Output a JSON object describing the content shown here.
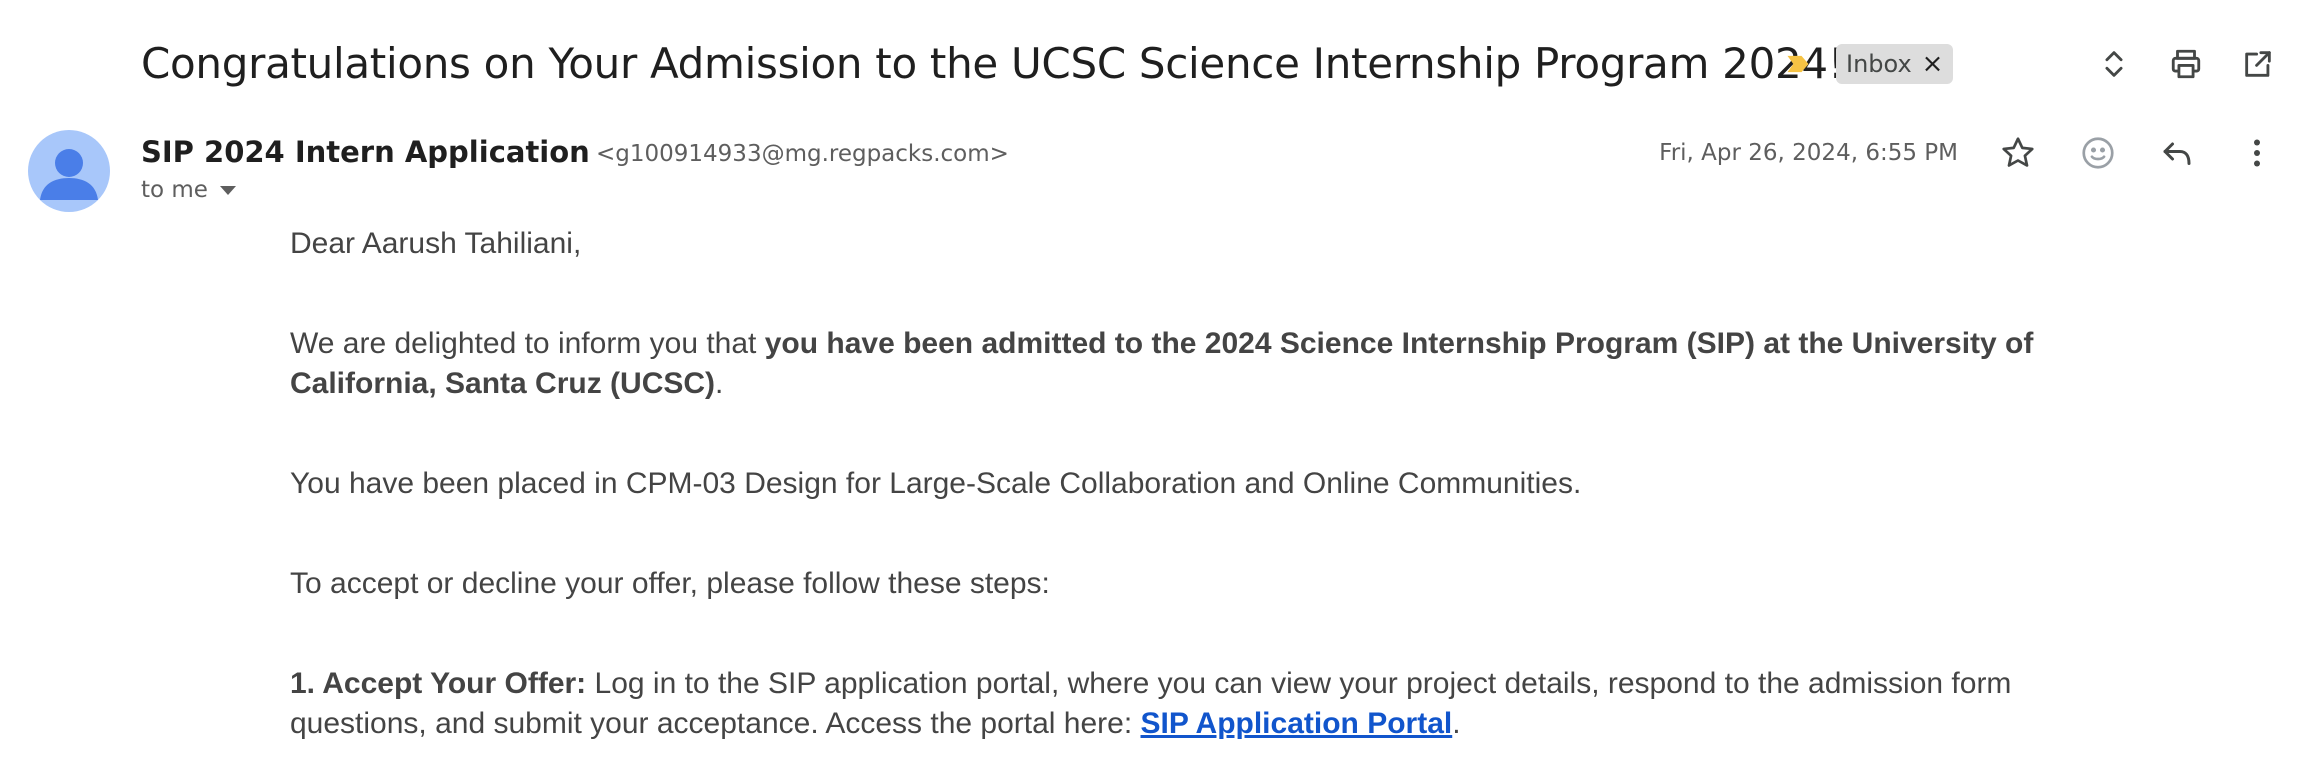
{
  "email": {
    "subject": "Congratulations on Your Admission to the UCSC Science Internship Program 2024!",
    "label": "Inbox",
    "label_remove": "×",
    "sender": {
      "name": "SIP 2024 Intern Application",
      "email": "<g100914933@mg.regpacks.com>",
      "recipient": "to me"
    },
    "date": "Fri, Apr 26, 2024, 6:55 PM",
    "body": {
      "greeting": "Dear Aarush Tahiliani,",
      "p1_start": "We are delighted to inform you that ",
      "p1_bold": "you have been admitted to the 2024 Science Internship Program (SIP) at the University of California, Santa Cruz (UCSC)",
      "p1_end": ".",
      "p2": "You have been placed in CPM-03 Design for Large-Scale Collaboration and Online Communities.",
      "p3": "To accept or decline your offer, please follow these steps:",
      "step1_title": "1. Accept Your Offer:",
      "step1_text": " Log in to the SIP application portal, where you can view your project details, respond to the admission form questions, and submit your acceptance. Access the portal here: ",
      "step1_link": "SIP Application Portal",
      "step1_end": "."
    }
  },
  "icons": {
    "important_marker": "label-important-icon",
    "expand_collapse": "unfold-more-icon",
    "print": "print-icon",
    "open_new_window": "open-in-new-icon",
    "star": "star-icon",
    "emoji": "emoji-reaction-icon",
    "reply": "reply-icon",
    "more": "more-vert-icon"
  },
  "colors": {
    "important_marker": "#f6c344",
    "avatar_bg": "#a8c7fa",
    "avatar_fg": "#4a7ee8",
    "link": "#1155cc",
    "label_chip": "#dddddd"
  }
}
